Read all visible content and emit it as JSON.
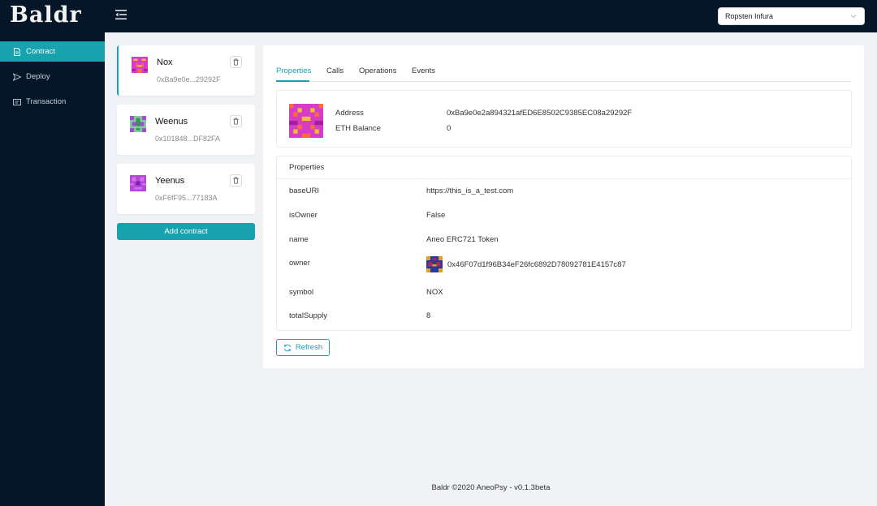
{
  "app": {
    "logo_text": "Baldr"
  },
  "header": {
    "network": "Ropsten Infura"
  },
  "sidebar": {
    "items": [
      {
        "label": "Contract",
        "icon": "file-icon",
        "active": true
      },
      {
        "label": "Deploy",
        "icon": "send-icon",
        "active": false
      },
      {
        "label": "Transaction",
        "icon": "transaction-icon",
        "active": false
      }
    ]
  },
  "contracts": [
    {
      "name": "Nox",
      "address": "0xBa9e0e...29292F"
    },
    {
      "name": "Weenus",
      "address": "0x101848...DF82FA"
    },
    {
      "name": "Yeenus",
      "address": "0xF6fF95...77183A"
    }
  ],
  "add_contract_label": "Add contract",
  "tabs": [
    "Properties",
    "Calls",
    "Operations",
    "Events"
  ],
  "info": {
    "address_label": "Address",
    "address_value": "0xBa9e0e2a894321afED6E8502C9385EC08a29292F",
    "balance_label": "ETH Balance",
    "balance_value": "0"
  },
  "properties": {
    "title": "Properties",
    "rows": [
      {
        "key": "baseURI",
        "value": "https://this_is_a_test.com"
      },
      {
        "key": "isOwner",
        "value": "False"
      },
      {
        "key": "name",
        "value": "Aneo ERC721 Token"
      },
      {
        "key": "owner",
        "value": "0x46F07d1f96B34eF26fc6892D78092781E4157c87"
      },
      {
        "key": "symbol",
        "value": "NOX"
      },
      {
        "key": "totalSupply",
        "value": "8"
      }
    ]
  },
  "refresh_label": "Refresh",
  "footer": "Baldr ©2020 AneoPsy - v0.1.3beta",
  "colors": {
    "accent": "#17a2ae",
    "dark": "#061629"
  }
}
